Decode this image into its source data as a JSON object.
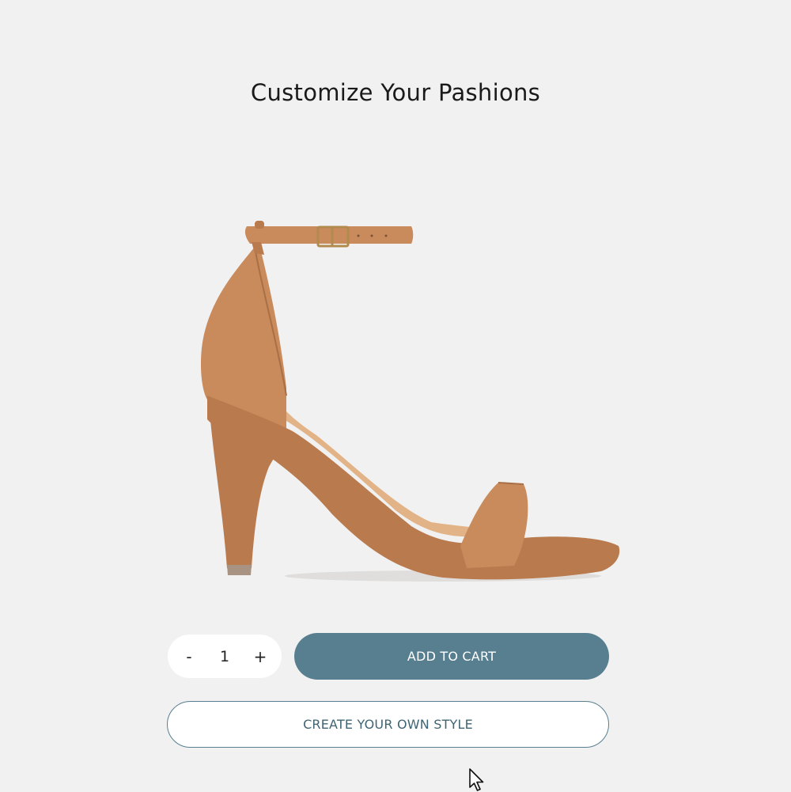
{
  "page": {
    "title": "Customize Your Pashions"
  },
  "product": {
    "image_icon": "high-heel-sandal-image",
    "color": "#c98a5c"
  },
  "quantity": {
    "decrement_label": "-",
    "value": "1",
    "increment_label": "+"
  },
  "actions": {
    "add_to_cart_label": "ADD TO CART",
    "create_style_label": "CREATE YOUR OWN STYLE"
  },
  "colors": {
    "background": "#f1f1f1",
    "accent": "#577f8f"
  }
}
